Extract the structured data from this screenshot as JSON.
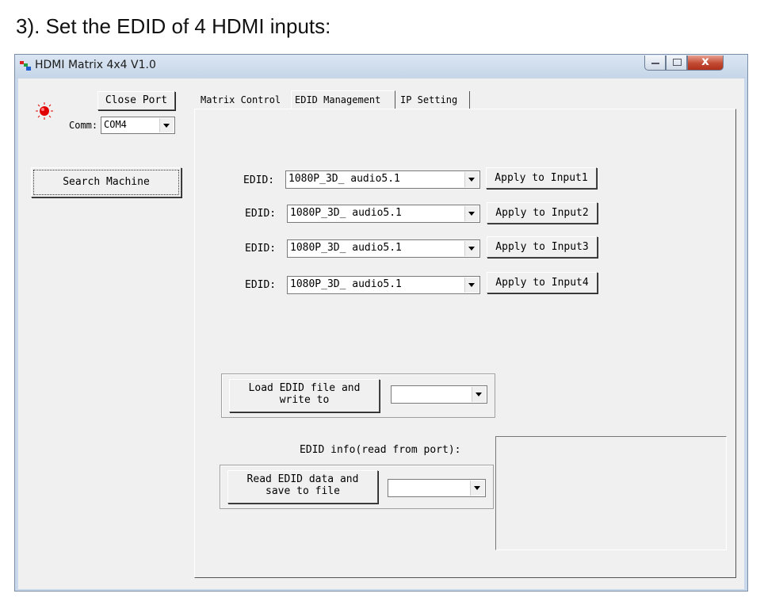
{
  "document": {
    "heading": "3). Set the EDID of 4 HDMI inputs:"
  },
  "window": {
    "title": "HDMI Matrix 4x4 V1.0",
    "close_glyph": "x"
  },
  "connection": {
    "close_port_label": "Close Port",
    "comm_label": "Comm:",
    "comm_value": "COM4",
    "search_label": "Search Machine",
    "led_color": "#e00000"
  },
  "tabs": [
    {
      "label": "Matrix Control"
    },
    {
      "label": "EDID Management",
      "active": true
    },
    {
      "label": "IP Setting"
    }
  ],
  "edid": {
    "rows": [
      {
        "label": "EDID:",
        "value": "1080P_3D_ audio5.1",
        "button": "Apply to Input1"
      },
      {
        "label": "EDID:",
        "value": "1080P_3D_ audio5.1",
        "button": "Apply to Input2"
      },
      {
        "label": "EDID:",
        "value": "1080P_3D_ audio5.1",
        "button": "Apply to Input3"
      },
      {
        "label": "EDID:",
        "value": "1080P_3D_ audio5.1",
        "button": "Apply to Input4"
      }
    ],
    "load_button": "Load EDID file and write to",
    "read_button": "Read EDID data and save to file",
    "info_label": "EDID info(read from port):"
  }
}
